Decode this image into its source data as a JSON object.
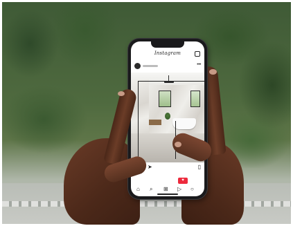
{
  "scene": {
    "description_tags": [
      "outdoor-background",
      "phone-in-hands"
    ]
  },
  "phone": {
    "app": {
      "name": "Instagram",
      "header_icons": [
        "direct-message-icon"
      ],
      "post": {
        "avatar": "avatar",
        "more_label": "•••",
        "image_subject": "bathroom",
        "actions": [
          "heart-icon",
          "comment-icon",
          "send-icon",
          "bookmark-icon"
        ]
      },
      "notification": {
        "icon": "heart-icon",
        "text": "♥"
      },
      "bottom_nav": [
        "home-icon",
        "search-icon",
        "add-icon",
        "reels-icon",
        "profile-icon"
      ]
    }
  },
  "colors": {
    "notification": "#ed2a3d",
    "skin": "#5a3222",
    "foliage": "#3f5a36"
  }
}
